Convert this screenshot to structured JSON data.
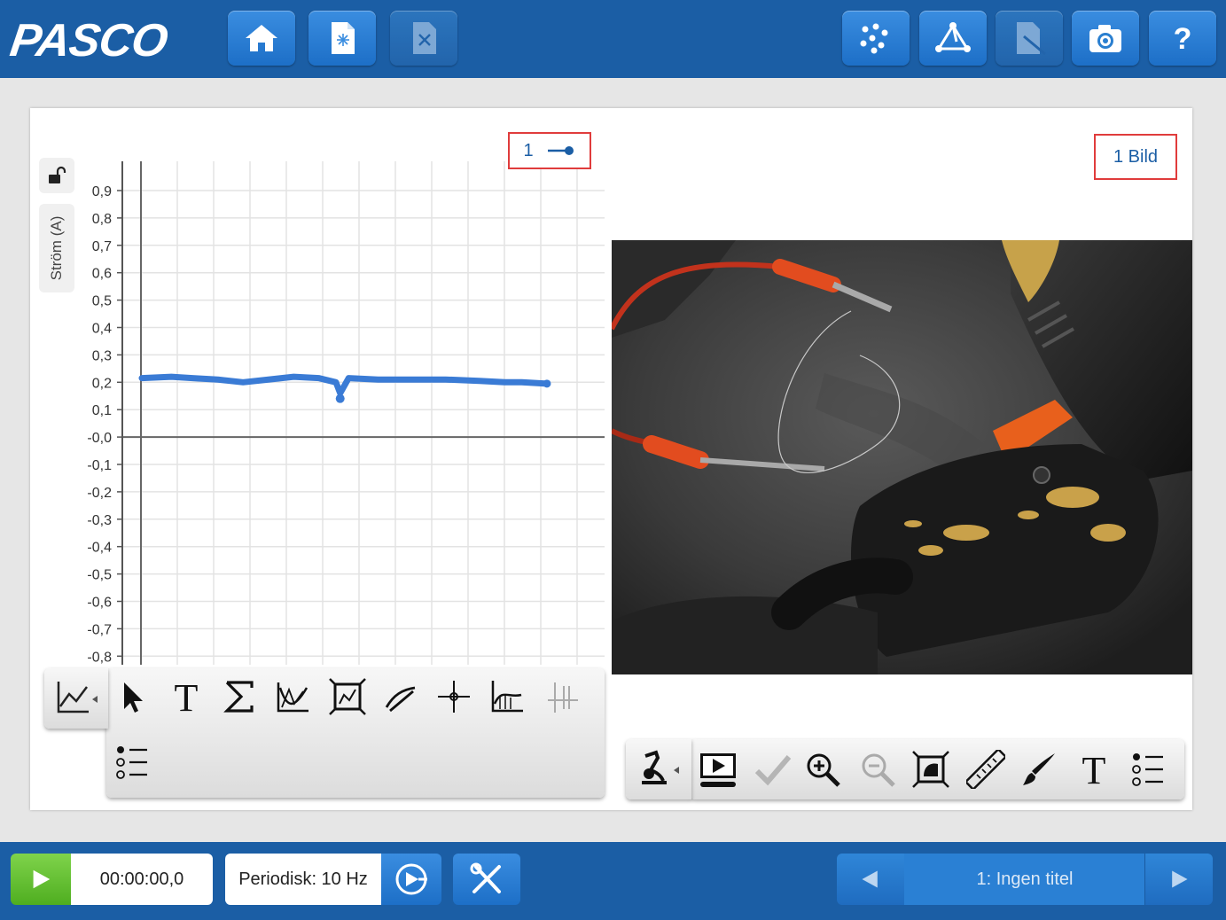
{
  "app": {
    "logo": "PASCO"
  },
  "toolbar": {
    "left": [
      "home-icon",
      "new-file-icon",
      "close-file-icon"
    ],
    "right": [
      "data-points-icon",
      "graph-network-icon",
      "annotate-icon",
      "camera-icon",
      "help-icon"
    ]
  },
  "graph": {
    "y_axis_label": "Ström (A)",
    "legend_run": "1"
  },
  "chart_data": {
    "type": "line",
    "ylabel": "Ström (A)",
    "yticks": [
      "0,9",
      "0,8",
      "0,7",
      "0,6",
      "0,5",
      "0,4",
      "0,3",
      "0,2",
      "0,1",
      "-0,0",
      "-0,1",
      "-0,2",
      "-0,3",
      "-0,4",
      "-0,5",
      "-0,6",
      "-0,7",
      "-0,8"
    ],
    "ylim": [
      -0.85,
      0.95
    ],
    "grid": true,
    "series": [
      {
        "name": "1",
        "color": "#3a7bd5",
        "points": [
          [
            0,
            0.215
          ],
          [
            0.07,
            0.22
          ],
          [
            0.12,
            0.215
          ],
          [
            0.18,
            0.21
          ],
          [
            0.24,
            0.2
          ],
          [
            0.3,
            0.21
          ],
          [
            0.36,
            0.22
          ],
          [
            0.42,
            0.215
          ],
          [
            0.46,
            0.2
          ],
          [
            0.47,
            0.16
          ],
          [
            0.49,
            0.215
          ],
          [
            0.56,
            0.21
          ],
          [
            0.64,
            0.21
          ],
          [
            0.72,
            0.21
          ],
          [
            0.8,
            0.205
          ],
          [
            0.86,
            0.2
          ],
          [
            0.9,
            0.2
          ],
          [
            0.96,
            0.195
          ]
        ]
      }
    ]
  },
  "image_panel": {
    "label": "1 Bild"
  },
  "graph_tools": [
    "graph-type-icon",
    "select-icon",
    "text-icon",
    "sum-icon",
    "curve-fit-icon",
    "scale-to-fit-icon",
    "slope-icon",
    "coordinates-icon",
    "area-icon",
    "delta-icon",
    "legend-icon"
  ],
  "image_tools": [
    "microscope-icon",
    "video-icon",
    "checkmark-icon",
    "zoom-in-icon",
    "zoom-out-icon",
    "fit-image-icon",
    "ruler-icon",
    "brush-icon",
    "text-icon",
    "legend-icon"
  ],
  "bottom": {
    "time": "00:00:00,0",
    "rate": "Periodisk: 10 Hz",
    "page_title": "1: Ingen titel"
  }
}
